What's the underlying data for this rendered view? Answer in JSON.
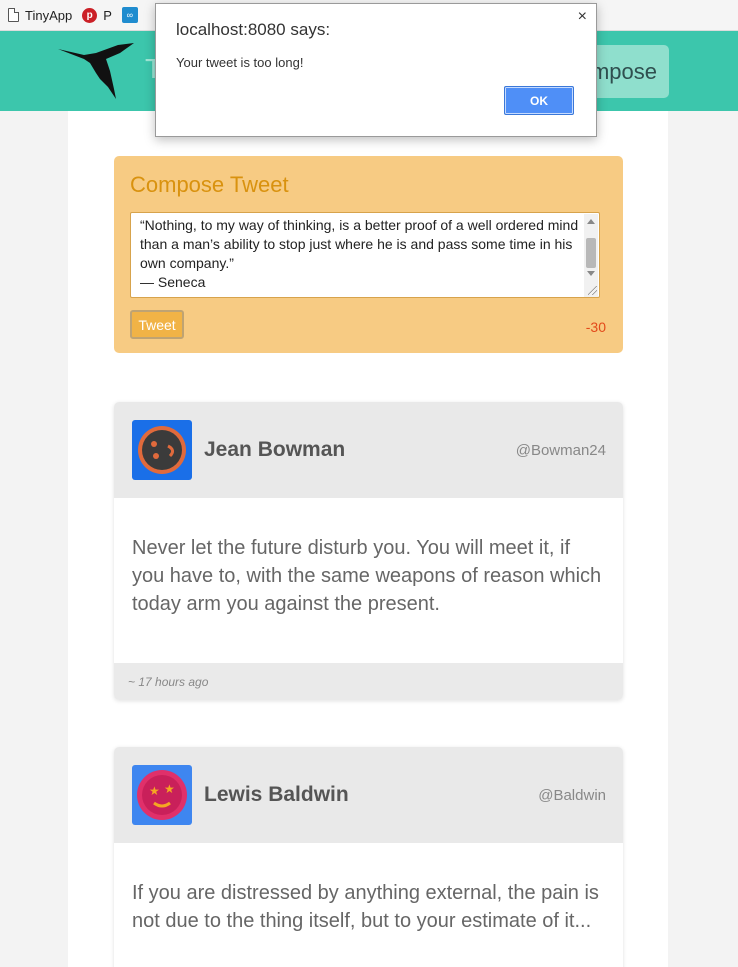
{
  "bookmarks": [
    {
      "label": "TinyApp",
      "icon": "page-icon"
    },
    {
      "label": "P",
      "icon": "pinterest-icon"
    },
    {
      "label": "",
      "icon": "link-icon"
    }
  ],
  "header": {
    "brand_partial": "T",
    "compose_label": "ompose"
  },
  "compose": {
    "title": "Compose Tweet",
    "text": "“Nothing, to my way of thinking, is a better proof of a well ordered mind than a man’s ability to stop just where he is and pass some time in his own company.”\n— Seneca",
    "button_label": "Tweet",
    "counter": "-30"
  },
  "tweets": [
    {
      "name": "Jean Bowman",
      "handle": "@Bowman24",
      "text": "Never let the future disturb you. You will meet it, if you have to, with the same weapons of reason which today arm you against the present.",
      "time": "~ 17 hours ago"
    },
    {
      "name": "Lewis Baldwin",
      "handle": "@Baldwin",
      "text": "If you are distressed by anything external, the pain is not due to the thing itself, but to your estimate of it..."
    }
  ],
  "alert": {
    "title": "localhost:8080 says:",
    "message": "Your tweet is too long!",
    "ok_label": "OK",
    "close_label": "×"
  },
  "colors": {
    "header_bg": "#3cc6ac",
    "compose_bg": "#f7cb83",
    "compose_title": "#d9920f",
    "counter_negative": "#e34a1b",
    "ok_button": "#4f8ff7"
  }
}
